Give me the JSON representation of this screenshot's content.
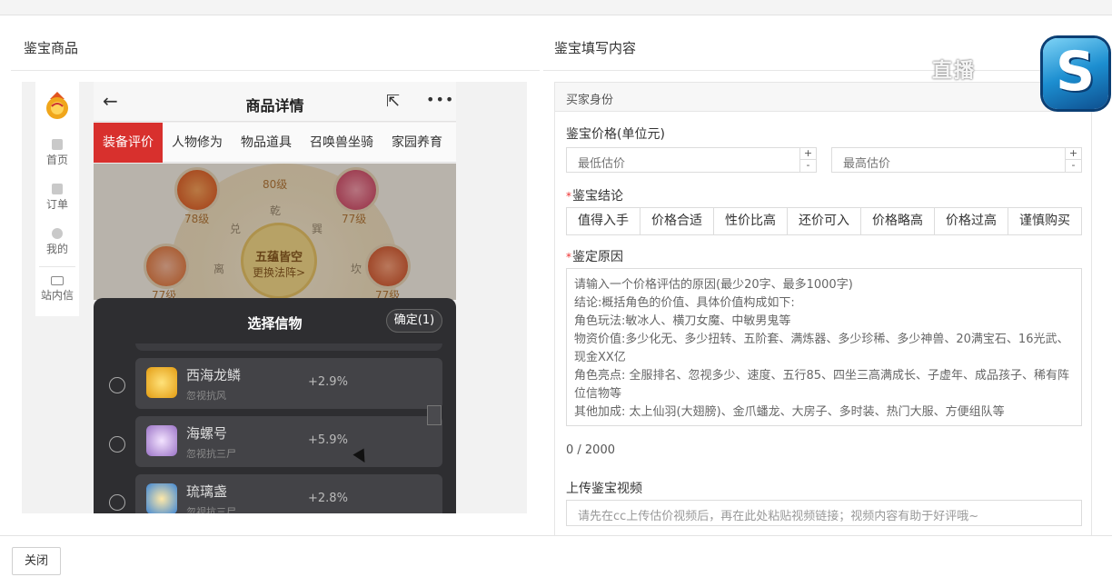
{
  "left_title": "鉴宝商品",
  "right_title": "鉴宝填写内容",
  "sidebar": {
    "items": [
      {
        "label": "首页",
        "icon": "home-icon"
      },
      {
        "label": "订单",
        "icon": "order-icon"
      },
      {
        "label": "我的",
        "icon": "user-icon"
      },
      {
        "label": "站内信",
        "icon": "mail-icon"
      }
    ]
  },
  "phone": {
    "title": "商品详情",
    "back_glyph": "←",
    "share_glyph": "⇱",
    "more_glyph": "•••",
    "tabs": [
      "装备评价",
      "人物修为",
      "物品道具",
      "召唤兽坐骑",
      "家园养育"
    ],
    "wheel": {
      "levels": [
        "80级",
        "78级",
        "77级",
        "77级",
        "77级"
      ],
      "trigrams": [
        "乾",
        "巽",
        "坎",
        "兑",
        "离"
      ],
      "center_line1": "五蕴皆空",
      "center_line2": "更换法阵>"
    },
    "sheet": {
      "title": "选择信物",
      "confirm": "确定(1)",
      "items": [
        {
          "name": "西海龙鳞",
          "sub": "忽视抗风",
          "pct": "+2.9%",
          "icon_color": "#f4c531"
        },
        {
          "name": "海螺号",
          "sub": "忽视抗三尸",
          "pct": "+5.9%",
          "icon_color": "#b58fd0"
        },
        {
          "name": "琉璃盏",
          "sub": "忽视抗三尸",
          "pct": "+2.8%",
          "icon_color": "#5aa6e8"
        }
      ]
    }
  },
  "form": {
    "section": "买家身份",
    "price_label": "鉴宝价格(单位元)",
    "min_placeholder": "最低估价",
    "max_placeholder": "最高估价",
    "plus": "+",
    "minus": "-",
    "required_mark": "*",
    "conclusion_label": "鉴宝结论",
    "conclusions": [
      "值得入手",
      "价格合适",
      "性价比高",
      "还价可入",
      "价格略高",
      "价格过高",
      "谨慎购买"
    ],
    "reason_label": "鉴定原因",
    "reason_lines": [
      "请输入一个价格评估的原因(最少20字、最多1000字)",
      "  结论:概括角色的价值、具体价值构成如下:",
      "  角色玩法:敏冰人、横刀女魔、中敏男鬼等",
      "  物资价值:多少化无、多少扭转、五阶套、满炼器、多少珍稀、多少神兽、20满宝石、16光武、现金XX亿",
      "  角色亮点: 全服排名、忽视多少、速度、五行85、四坐三高满成长、子虚年、成品孩子、稀有阵位信物等",
      "  其他加成: 太上仙羽(大翅膀)、金爪蟠龙、大房子、多时装、热门大服、方便组队等"
    ],
    "count": "0 / 2000",
    "video_label": "上传鉴宝视频",
    "video_placeholder": "请先在cc上传估价视频后，再在此处粘贴视频链接；视频内容有助于好评哦~"
  },
  "watermark": {
    "text": "直播",
    "badge": "S"
  },
  "footer": {
    "close": "关闭"
  }
}
